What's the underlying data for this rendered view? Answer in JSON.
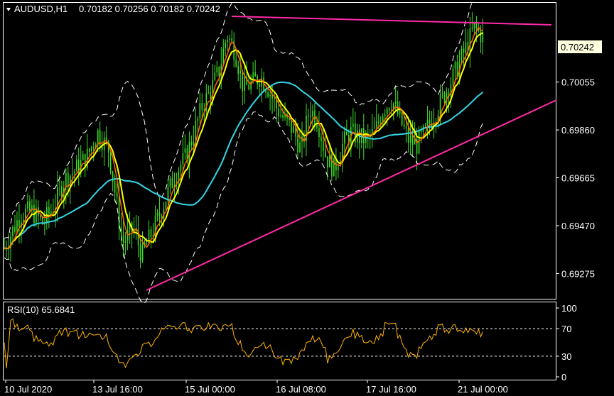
{
  "header": {
    "symbol_tf": "AUDUSD,H1",
    "ohlc": "0.70182 0.70256 0.70182 0.70242"
  },
  "current_price_label": "0.70242",
  "rsi_label": "RSI(10) 65.6841",
  "colors": {
    "background": "#000000",
    "frame": "#ffffff",
    "candles": "#3fdc2a",
    "ma_fast": "#ff6a00",
    "ma_mid": "#ffff00",
    "ma_slow": "#33d6e6",
    "envelope": "#ffffff",
    "trendline": "#ff2aa6",
    "rsi_line": "#ffb300",
    "price_tag_bg": "#ffffe0"
  },
  "chart_data": [
    {
      "type": "line",
      "title": "AUDUSD,H1",
      "y_ticks": [
        "0.70055",
        "0.69860",
        "0.69665",
        "0.69470",
        "0.69275"
      ],
      "y_tick_values": [
        0.70055,
        0.6986,
        0.69665,
        0.6947,
        0.69275
      ],
      "ylim": [
        0.69175,
        0.70375
      ],
      "x_ticks": [
        "10 Jul 2020",
        "13 Jul 16:00",
        "15 Jul 00:00",
        "16 Jul 08:00",
        "17 Jul 16:00",
        "21 Jul 00:00"
      ],
      "last_price": 0.70242,
      "series_points": [
        0,
        0.6935
      ],
      "price_path": [
        [
          0,
          0.6938
        ],
        [
          0.015,
          0.6945
        ],
        [
          0.03,
          0.6952
        ],
        [
          0.05,
          0.6953
        ],
        [
          0.07,
          0.6948
        ],
        [
          0.09,
          0.6955
        ],
        [
          0.11,
          0.6966
        ],
        [
          0.13,
          0.697
        ],
        [
          0.15,
          0.6975
        ],
        [
          0.17,
          0.6985
        ],
        [
          0.19,
          0.6978
        ],
        [
          0.205,
          0.6955
        ],
        [
          0.215,
          0.694
        ],
        [
          0.235,
          0.6946
        ],
        [
          0.25,
          0.6935
        ],
        [
          0.26,
          0.694
        ],
        [
          0.27,
          0.6945
        ],
        [
          0.285,
          0.6953
        ],
        [
          0.3,
          0.6962
        ],
        [
          0.315,
          0.697
        ],
        [
          0.33,
          0.6975
        ],
        [
          0.345,
          0.6985
        ],
        [
          0.36,
          0.6996
        ],
        [
          0.375,
          0.7002
        ],
        [
          0.39,
          0.701
        ],
        [
          0.405,
          0.7025
        ],
        [
          0.42,
          0.7018
        ],
        [
          0.435,
          0.7003
        ],
        [
          0.45,
          0.7005
        ],
        [
          0.465,
          0.7008
        ],
        [
          0.48,
          0.7003
        ],
        [
          0.495,
          0.6995
        ],
        [
          0.51,
          0.699
        ],
        [
          0.525,
          0.6986
        ],
        [
          0.54,
          0.6978
        ],
        [
          0.555,
          0.6995
        ],
        [
          0.57,
          0.699
        ],
        [
          0.585,
          0.6975
        ],
        [
          0.6,
          0.697
        ],
        [
          0.615,
          0.698
        ],
        [
          0.63,
          0.6985
        ],
        [
          0.645,
          0.6983
        ],
        [
          0.66,
          0.6982
        ],
        [
          0.675,
          0.6986
        ],
        [
          0.69,
          0.6995
        ],
        [
          0.705,
          0.6998
        ],
        [
          0.72,
          0.699
        ],
        [
          0.735,
          0.6982
        ],
        [
          0.75,
          0.698
        ],
        [
          0.765,
          0.6985
        ],
        [
          0.78,
          0.6992
        ],
        [
          0.795,
          0.6998
        ],
        [
          0.81,
          0.7005
        ],
        [
          0.825,
          0.7012
        ],
        [
          0.84,
          0.702
        ],
        [
          0.855,
          0.7028
        ],
        [
          0.87,
          0.7024
        ]
      ]
    },
    {
      "type": "line",
      "title": "RSI(10) 65.6841",
      "y_ticks": [
        "100",
        "70",
        "30",
        "0"
      ],
      "ylim": [
        0,
        100
      ],
      "levels": [
        70,
        30
      ],
      "last_value": 65.6841
    }
  ]
}
